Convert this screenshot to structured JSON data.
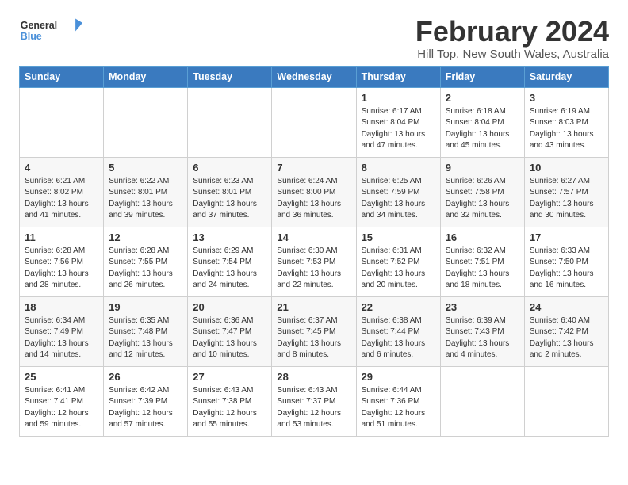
{
  "logo": {
    "general": "General",
    "blue": "Blue"
  },
  "title": "February 2024",
  "subtitle": "Hill Top, New South Wales, Australia",
  "days_of_week": [
    "Sunday",
    "Monday",
    "Tuesday",
    "Wednesday",
    "Thursday",
    "Friday",
    "Saturday"
  ],
  "weeks": [
    [
      {
        "day": "",
        "content": ""
      },
      {
        "day": "",
        "content": ""
      },
      {
        "day": "",
        "content": ""
      },
      {
        "day": "",
        "content": ""
      },
      {
        "day": "1",
        "content": "Sunrise: 6:17 AM\nSunset: 8:04 PM\nDaylight: 13 hours and 47 minutes."
      },
      {
        "day": "2",
        "content": "Sunrise: 6:18 AM\nSunset: 8:04 PM\nDaylight: 13 hours and 45 minutes."
      },
      {
        "day": "3",
        "content": "Sunrise: 6:19 AM\nSunset: 8:03 PM\nDaylight: 13 hours and 43 minutes."
      }
    ],
    [
      {
        "day": "4",
        "content": "Sunrise: 6:21 AM\nSunset: 8:02 PM\nDaylight: 13 hours and 41 minutes."
      },
      {
        "day": "5",
        "content": "Sunrise: 6:22 AM\nSunset: 8:01 PM\nDaylight: 13 hours and 39 minutes."
      },
      {
        "day": "6",
        "content": "Sunrise: 6:23 AM\nSunset: 8:01 PM\nDaylight: 13 hours and 37 minutes."
      },
      {
        "day": "7",
        "content": "Sunrise: 6:24 AM\nSunset: 8:00 PM\nDaylight: 13 hours and 36 minutes."
      },
      {
        "day": "8",
        "content": "Sunrise: 6:25 AM\nSunset: 7:59 PM\nDaylight: 13 hours and 34 minutes."
      },
      {
        "day": "9",
        "content": "Sunrise: 6:26 AM\nSunset: 7:58 PM\nDaylight: 13 hours and 32 minutes."
      },
      {
        "day": "10",
        "content": "Sunrise: 6:27 AM\nSunset: 7:57 PM\nDaylight: 13 hours and 30 minutes."
      }
    ],
    [
      {
        "day": "11",
        "content": "Sunrise: 6:28 AM\nSunset: 7:56 PM\nDaylight: 13 hours and 28 minutes."
      },
      {
        "day": "12",
        "content": "Sunrise: 6:28 AM\nSunset: 7:55 PM\nDaylight: 13 hours and 26 minutes."
      },
      {
        "day": "13",
        "content": "Sunrise: 6:29 AM\nSunset: 7:54 PM\nDaylight: 13 hours and 24 minutes."
      },
      {
        "day": "14",
        "content": "Sunrise: 6:30 AM\nSunset: 7:53 PM\nDaylight: 13 hours and 22 minutes."
      },
      {
        "day": "15",
        "content": "Sunrise: 6:31 AM\nSunset: 7:52 PM\nDaylight: 13 hours and 20 minutes."
      },
      {
        "day": "16",
        "content": "Sunrise: 6:32 AM\nSunset: 7:51 PM\nDaylight: 13 hours and 18 minutes."
      },
      {
        "day": "17",
        "content": "Sunrise: 6:33 AM\nSunset: 7:50 PM\nDaylight: 13 hours and 16 minutes."
      }
    ],
    [
      {
        "day": "18",
        "content": "Sunrise: 6:34 AM\nSunset: 7:49 PM\nDaylight: 13 hours and 14 minutes."
      },
      {
        "day": "19",
        "content": "Sunrise: 6:35 AM\nSunset: 7:48 PM\nDaylight: 13 hours and 12 minutes."
      },
      {
        "day": "20",
        "content": "Sunrise: 6:36 AM\nSunset: 7:47 PM\nDaylight: 13 hours and 10 minutes."
      },
      {
        "day": "21",
        "content": "Sunrise: 6:37 AM\nSunset: 7:45 PM\nDaylight: 13 hours and 8 minutes."
      },
      {
        "day": "22",
        "content": "Sunrise: 6:38 AM\nSunset: 7:44 PM\nDaylight: 13 hours and 6 minutes."
      },
      {
        "day": "23",
        "content": "Sunrise: 6:39 AM\nSunset: 7:43 PM\nDaylight: 13 hours and 4 minutes."
      },
      {
        "day": "24",
        "content": "Sunrise: 6:40 AM\nSunset: 7:42 PM\nDaylight: 13 hours and 2 minutes."
      }
    ],
    [
      {
        "day": "25",
        "content": "Sunrise: 6:41 AM\nSunset: 7:41 PM\nDaylight: 12 hours and 59 minutes."
      },
      {
        "day": "26",
        "content": "Sunrise: 6:42 AM\nSunset: 7:39 PM\nDaylight: 12 hours and 57 minutes."
      },
      {
        "day": "27",
        "content": "Sunrise: 6:43 AM\nSunset: 7:38 PM\nDaylight: 12 hours and 55 minutes."
      },
      {
        "day": "28",
        "content": "Sunrise: 6:43 AM\nSunset: 7:37 PM\nDaylight: 12 hours and 53 minutes."
      },
      {
        "day": "29",
        "content": "Sunrise: 6:44 AM\nSunset: 7:36 PM\nDaylight: 12 hours and 51 minutes."
      },
      {
        "day": "",
        "content": ""
      },
      {
        "day": "",
        "content": ""
      }
    ]
  ]
}
